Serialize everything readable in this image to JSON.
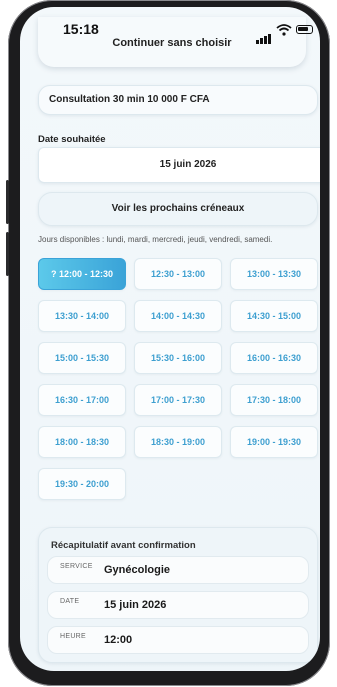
{
  "status_bar": {
    "time": "15:18"
  },
  "header": {
    "continue_label": "Continuer sans choisir"
  },
  "consultation": {
    "label": "Consultation 30 min 10 000 F CFA"
  },
  "date": {
    "label": "Date souhaitée",
    "value": "15 juin 2026"
  },
  "next_slots": {
    "label": "Voir les prochains créneaux"
  },
  "availability": {
    "text": "Jours disponibles : lundi, mardi, mercredi, jeudi, vendredi, samedi."
  },
  "slots": [
    {
      "label": "?  12:00 - 12:30",
      "selected": true
    },
    {
      "label": "12:30 - 13:00"
    },
    {
      "label": "13:00 - 13:30"
    },
    {
      "label": "13:30 - 14:00"
    },
    {
      "label": "14:00 - 14:30"
    },
    {
      "label": "14:30 - 15:00"
    },
    {
      "label": "15:00 - 15:30"
    },
    {
      "label": "15:30 - 16:00"
    },
    {
      "label": "16:00 - 16:30"
    },
    {
      "label": "16:30 - 17:00"
    },
    {
      "label": "17:00 - 17:30"
    },
    {
      "label": "17:30 - 18:00"
    },
    {
      "label": "18:00 - 18:30"
    },
    {
      "label": "18:30 - 19:00"
    },
    {
      "label": "19:00 - 19:30"
    },
    {
      "label": "19:30 - 20:00"
    }
  ],
  "summary": {
    "title": "Récapitulatif avant confirmation",
    "rows": [
      {
        "key": "SERVICE",
        "value": "Gynécologie"
      },
      {
        "key": "DATE",
        "value": "15 juin 2026"
      },
      {
        "key": "HEURE",
        "value": "12:00"
      }
    ]
  },
  "colors": {
    "accent": "#3aa3d8",
    "accent_light": "#5cc9ea",
    "slot_text": "#3d9fd0"
  }
}
